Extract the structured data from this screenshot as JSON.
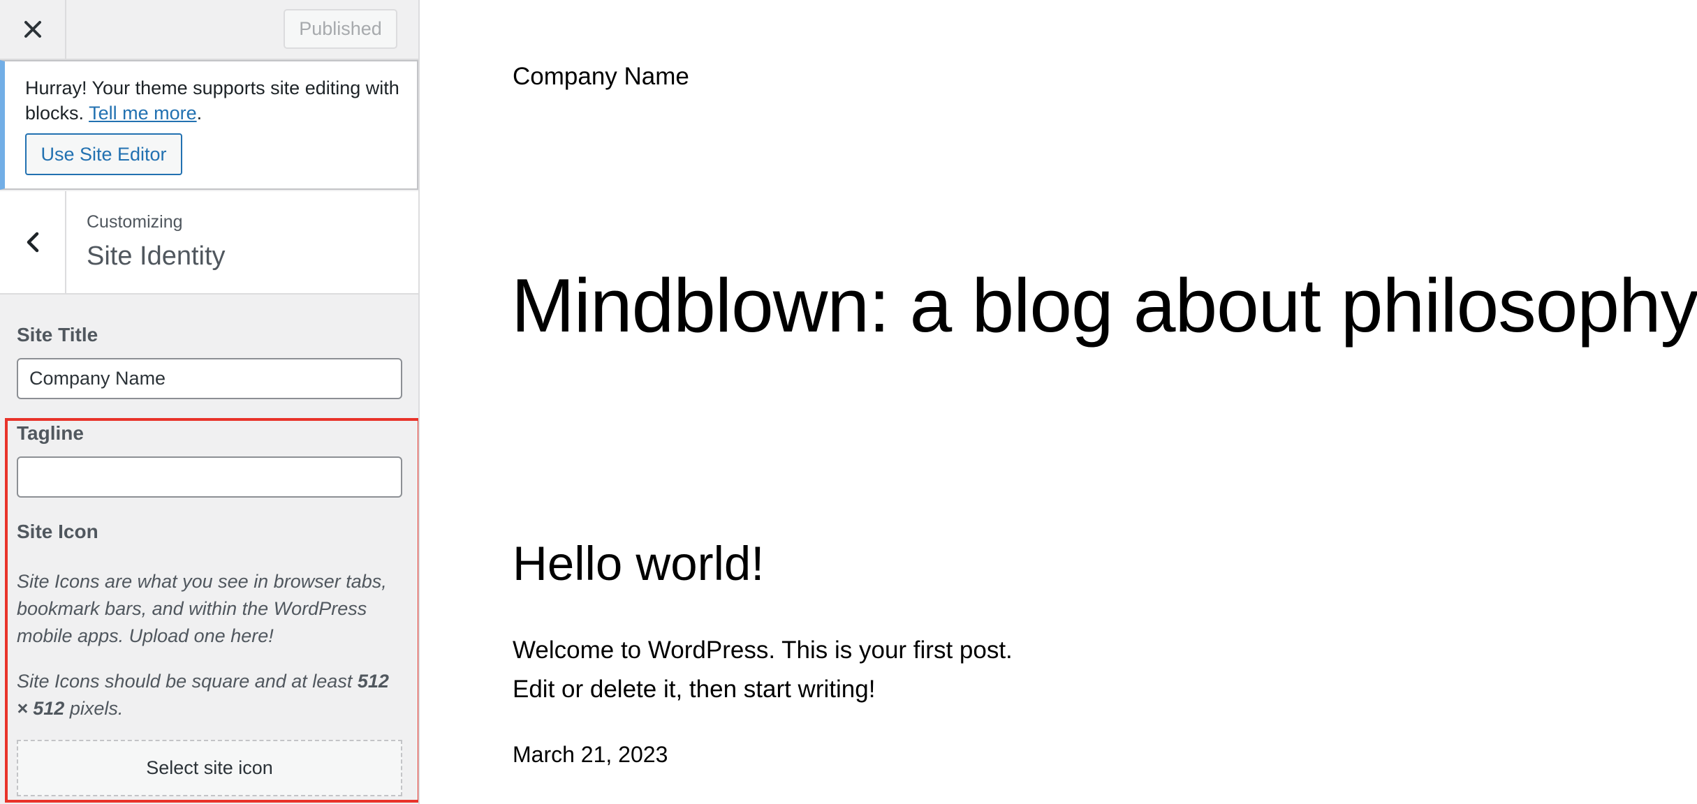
{
  "topbar": {
    "close_icon": "close-x-icon",
    "publish_label": "Published"
  },
  "notice": {
    "text": "Hurray! Your theme supports site editing with blocks.",
    "link_text": "Tell me more",
    "suffix": ".",
    "button_label": "Use Site Editor",
    "accent_color": "#72aee6"
  },
  "section": {
    "back_icon": "chevron-left-icon",
    "crumb": "Customizing",
    "title": "Site Identity"
  },
  "site_title": {
    "label": "Site Title",
    "value": "Company Name"
  },
  "tagline": {
    "label": "Tagline",
    "value": ""
  },
  "site_icon": {
    "label": "Site Icon",
    "desc1": "Site Icons are what you see in browser tabs, bookmark bars, and within the WordPress mobile apps. Upload one here!",
    "desc2_pre": "Site Icons should be square and at least ",
    "desc2_bold": "512 × 512",
    "desc2_post": " pixels.",
    "button_label": "Select site icon"
  },
  "highlight_color": "#e8332a",
  "preview": {
    "site_title": "Company Name",
    "headline": "Mindblown: a blog about philosophy.",
    "post_title": "Hello world!",
    "post_line1": "Welcome to WordPress. This is your first post.",
    "post_line2": "Edit or delete it, then start writing!",
    "post_date": "March 21, 2023"
  }
}
